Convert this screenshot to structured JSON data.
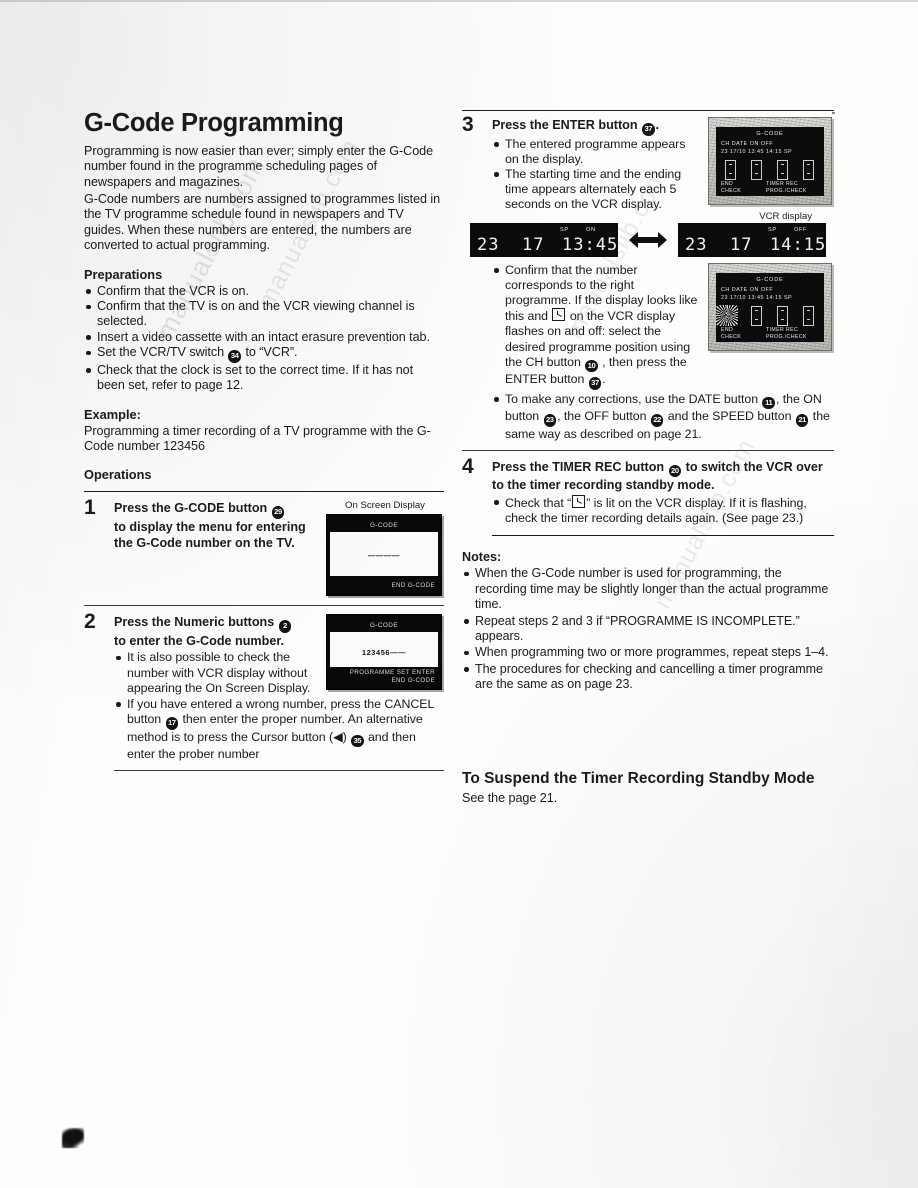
{
  "document": {
    "title": "G-Code Programming",
    "intro_paragraphs": [
      "Programming is now easier than ever; simply enter the G-Code number found in the programme scheduling pages of newspapers and magazines.",
      "G-Code numbers are numbers assigned to programmes listed in the TV programme schedule found in newspapers and TV guides. When these numbers are entered, the numbers are converted to actual programming."
    ]
  },
  "preparations": {
    "heading": "Preparations",
    "items": [
      "Confirm that the VCR is on.",
      "Confirm that the TV is on and the VCR viewing channel is selected.",
      "Insert a video cassette with an intact erasure prevention tab.",
      "Set the VCR/TV switch",
      "Check that the clock is set to the correct time. If it has not been set, refer to page 12."
    ],
    "switch_ref": "34",
    "switch_tail": "to “VCR”."
  },
  "example": {
    "heading": "Example:",
    "text": "Programming a timer recording of a TV programme with the G-Code number 123456"
  },
  "operations": {
    "heading": "Operations",
    "step1": {
      "number": "1",
      "head_a": "Press the G-CODE button",
      "ref": "29",
      "head_b": "to display the menu for entering the G-Code number on the TV.",
      "osd_caption": "On Screen Display",
      "osd": {
        "top": "G-CODE",
        "middle": "————",
        "bottom": "END G-CODE"
      }
    },
    "step2": {
      "number": "2",
      "head_a": "Press the Numeric buttons",
      "ref": "2",
      "head_b": "to enter the G-Code number.",
      "bullets": [
        "It is also possible to check the number with VCR display without appearing the On Screen Display."
      ],
      "bullet2_a": "If you have entered a wrong number, press the CANCEL button",
      "bullet2_ref1": "17",
      "bullet2_b": "then enter the proper number. An alternative method is to press the Cursor button (◀)",
      "bullet2_ref2": "35",
      "bullet2_c": "and then enter the prober number",
      "osd": {
        "top": "G-CODE",
        "middle": "123456——",
        "bottom_line1": "PROGRAMME SET ENTER",
        "bottom_line2": "END G-CODE"
      }
    },
    "step3": {
      "number": "3",
      "head_a": "Press the ENTER button",
      "ref": "37",
      "head_b": ".",
      "bullets": [
        "The entered programme appears on the display.",
        "The starting time and the ending time appears alternately each 5 seconds on the VCR display."
      ],
      "confirm_a": "Confirm that the number corresponds to the right programme. If the display looks like this and",
      "confirm_glyph": "timer-icon",
      "confirm_b": "on the VCR display flashes on and off: select the desired programme position using the CH button",
      "confirm_ref1": "10",
      "confirm_c": ", then press the ENTER button",
      "confirm_ref2": "37",
      "confirm_d": ".",
      "correct_a": "To make any corrections, use the DATE button",
      "correct_ref1": "11",
      "correct_b": ", the ON button",
      "correct_ref2": "23",
      "correct_c": ", the OFF button",
      "correct_ref3": "22",
      "correct_d": "and the SPEED button",
      "correct_ref4": "21",
      "correct_e": "the same way as described on page 21."
    },
    "step4": {
      "number": "4",
      "head_a": "Press the TIMER REC button",
      "ref": "20",
      "head_b": "to switch the VCR over to the timer recording standby mode.",
      "bullet_a": "Check that “",
      "bullet_glyph": "timer-icon",
      "bullet_b": "” is lit on the VCR display. If it is flashing, check the timer recording details again. (See page 23.)"
    }
  },
  "vcr_panel": {
    "lcd_title": "G-CODE",
    "lcd_header": "CH   DATE    ON        OFF",
    "lcd_values": "23   17/10   13:45   14:15   SP",
    "footer_left_line1": "END",
    "footer_left_line2": "CHECK",
    "footer_right_line1": "TIMER REC",
    "footer_right_line2": "PROG./CHECK"
  },
  "vcr_display": {
    "caption": "VCR display",
    "left": {
      "channel": "23",
      "date": "17",
      "time": "13:45",
      "tag_speed": "SP",
      "tag_mode": "ON"
    },
    "right": {
      "channel": "23",
      "date": "17",
      "time": "14:15",
      "tag_speed": "SP",
      "tag_mode": "OFF"
    }
  },
  "notes": {
    "heading": "Notes:",
    "items": [
      "When the G-Code number is used for programming, the recording time may be slightly longer than the actual programme time.",
      "Repeat steps 2 and 3 if “PROGRAMME IS INCOMPLETE.” appears.",
      "When programming two or more programmes, repeat steps 1–4.",
      "The procedures for checking and cancelling a timer programme are the same as on page 23."
    ]
  },
  "suspend": {
    "heading": "To Suspend the Timer Recording Standby Mode",
    "text": "See the page 21."
  },
  "watermarks": [
    "manualslib.com",
    "manualslib.com",
    "manualslib.com",
    "manualslib.com"
  ]
}
